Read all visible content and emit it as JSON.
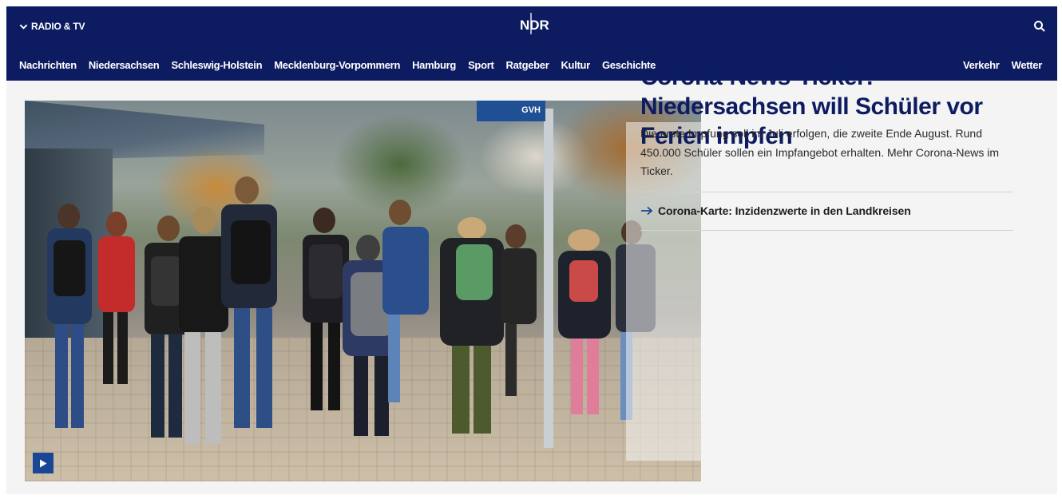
{
  "header": {
    "radio_tv_label": "RADIO & TV",
    "logo_text": "NDR",
    "nav": [
      "Nachrichten",
      "Niedersachsen",
      "Schleswig-Holstein",
      "Mecklenburg-Vorpommern",
      "Hamburg",
      "Sport",
      "Ratgeber",
      "Kultur",
      "Geschichte"
    ],
    "util_nav": [
      "Verkehr",
      "Wetter"
    ]
  },
  "hero": {
    "sign_text": "GVH",
    "headline": "Corona-News-Ticker: Niedersachsen will Schüler vor Ferien impfen",
    "teaser": "Die erste Impfung soll im Juli erfolgen, die zweite Ende August. Rund 450.000 Schüler sollen ein Impfangebot erhalten. Mehr Corona-News im Ticker.",
    "related_link": "Corona-Karte: Inzidenzwerte in den Landkreisen"
  },
  "colors": {
    "header_bg": "#0d1c60",
    "headline": "#0d1c60",
    "play_button": "#1a4696",
    "related_arrow": "#1a4696"
  },
  "icons": {
    "radio_tv": "chevron-down-icon",
    "search": "search-icon",
    "play": "play-icon",
    "related": "arrow-right-icon"
  }
}
